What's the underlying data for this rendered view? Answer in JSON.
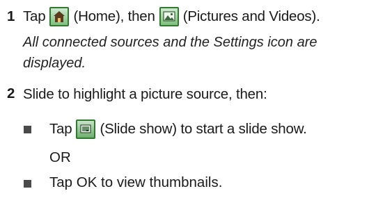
{
  "step1": {
    "number": "1",
    "tap": "Tap",
    "home_label": "(Home), then",
    "pictures_label": "(Pictures and Videos).",
    "note_line1": "All connected sources and the Settings icon are",
    "note_line2": "displayed.",
    "home_icon": "home-icon",
    "pictures_icon": "pictures-videos-icon"
  },
  "step2": {
    "number": "2",
    "text": "Slide to highlight a picture source, then:",
    "bullet1_tap": "Tap",
    "bullet1_label": "(Slide show) to start a slide show.",
    "or": "OR",
    "bullet2": "Tap OK to view thumbnails.",
    "slideshow_icon": "slideshow-icon"
  },
  "colors": {
    "icon_border": "#2f7a2f",
    "bullet": "#4a4a4a",
    "text": "#1a1a1a"
  }
}
